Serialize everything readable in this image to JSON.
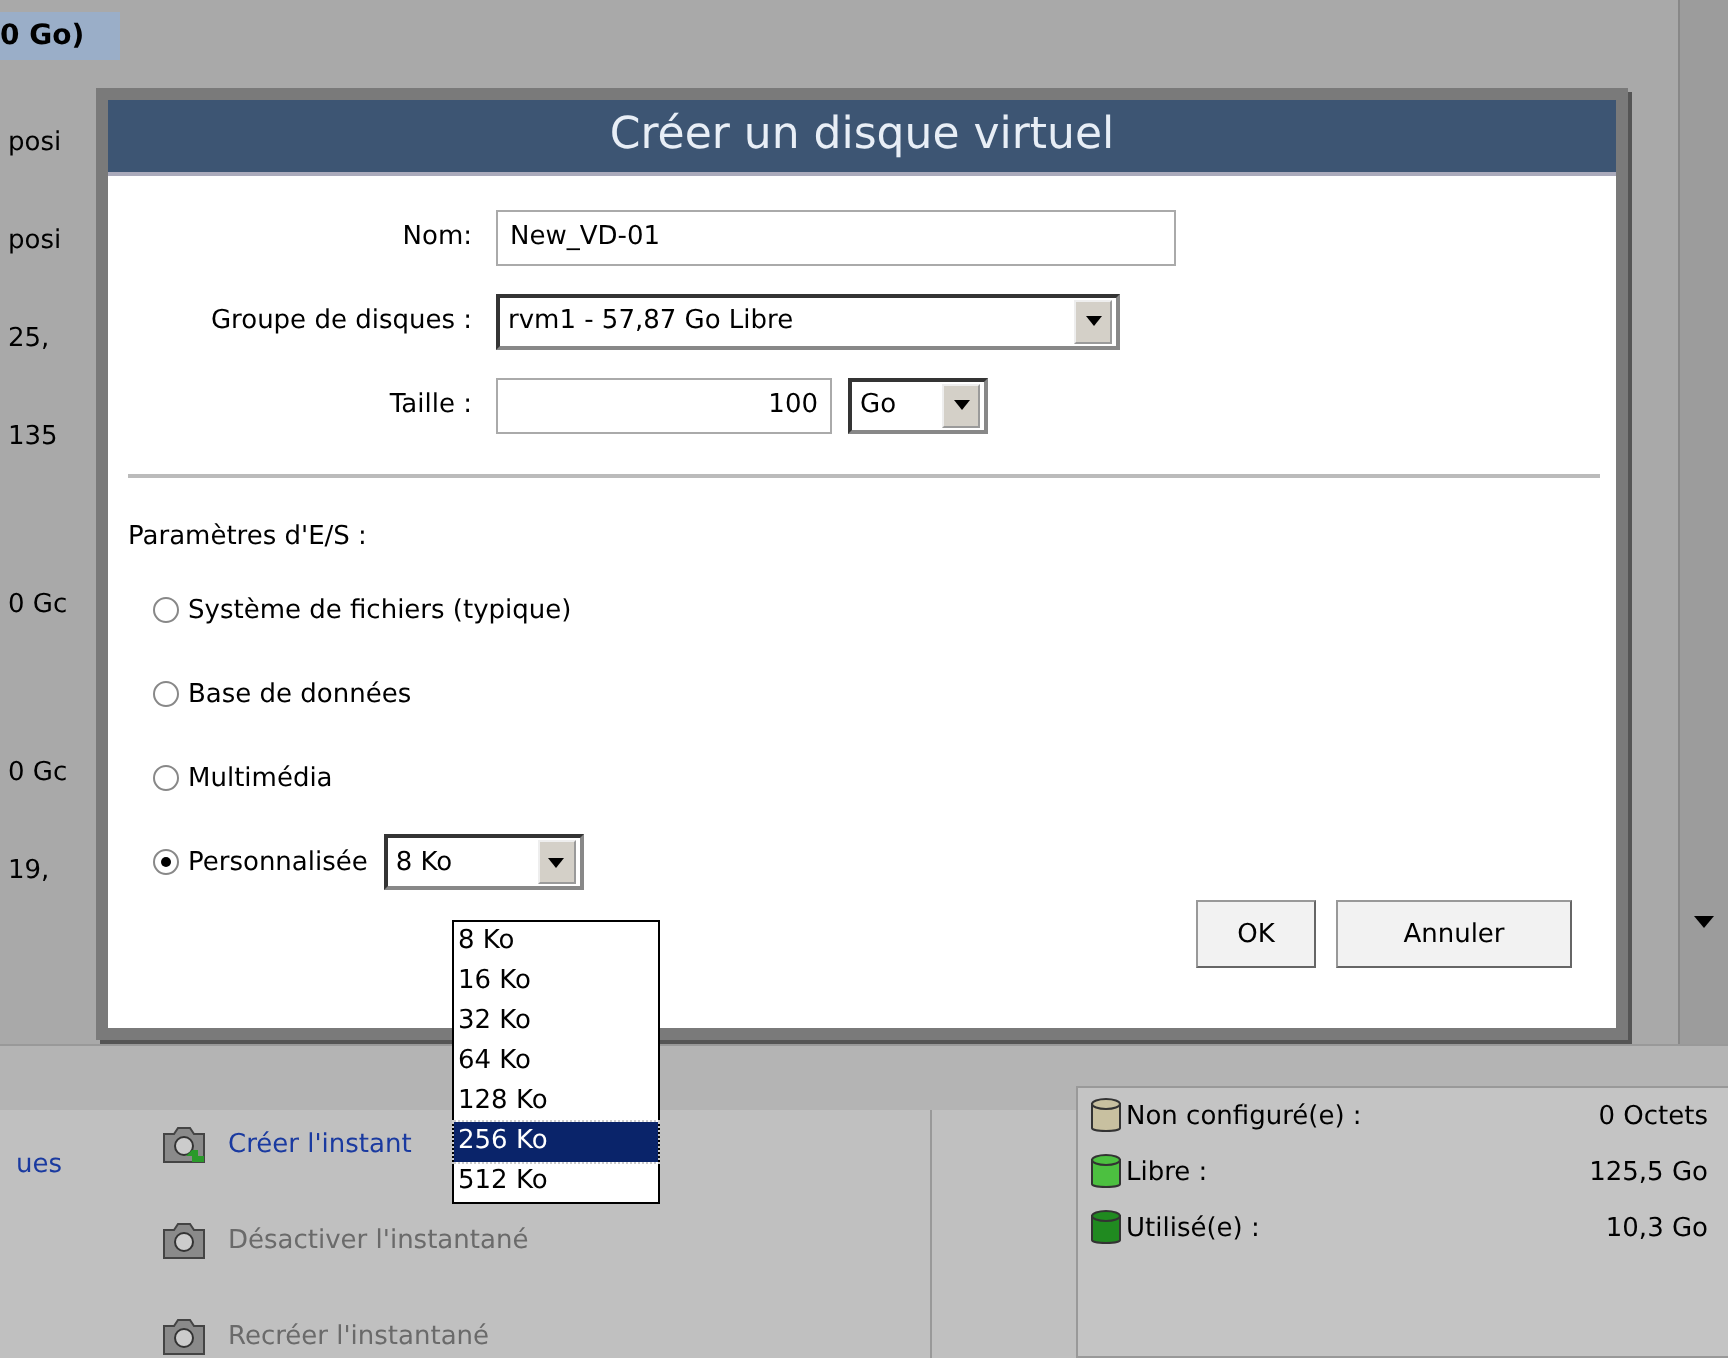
{
  "background": {
    "column_fragments": [
      {
        "text": "0 Go)",
        "kind": "header"
      },
      {
        "text": "posi",
        "kind": "cell"
      },
      {
        "text": "posi",
        "kind": "cell"
      },
      {
        "text": "25,",
        "kind": "cell"
      },
      {
        "text": "135",
        "kind": "cell"
      },
      {
        "text": "0 Gc",
        "kind": "cell"
      },
      {
        "text": "0 Gc",
        "kind": "cell"
      },
      {
        "text": "19,",
        "kind": "cell"
      }
    ],
    "left_link": "ues",
    "actions": [
      {
        "label": "Créer l'instant",
        "disabled": false
      },
      {
        "label": "Désactiver l'instantané",
        "disabled": true
      },
      {
        "label": "Recréer l'instantané",
        "disabled": true
      }
    ],
    "legend": [
      {
        "label": "Non configuré(e) :",
        "value": "0 Octets",
        "color": "#c8c0a0"
      },
      {
        "label": "Libre :",
        "value": "125,5 Go",
        "color": "#4cc040"
      },
      {
        "label": "Utilisé(e) :",
        "value": "10,3 Go",
        "color": "#208a20"
      }
    ]
  },
  "dialog": {
    "title": "Créer un disque virtuel",
    "name": {
      "label": "Nom:",
      "value": "New_VD-01"
    },
    "disk_group": {
      "label": "Groupe de disques :",
      "value": "rvm1 - 57,87 Go Libre"
    },
    "size": {
      "label": "Taille :",
      "value": "100",
      "unit": "Go"
    },
    "io_label": "Paramètres d'E/S :",
    "io_options": [
      {
        "label": "Système de fichiers (typique)",
        "selected": false
      },
      {
        "label": "Base de données",
        "selected": false
      },
      {
        "label": "Multimédia",
        "selected": false
      },
      {
        "label": "Personnalisée",
        "selected": true
      }
    ],
    "custom_select": "8 Ko",
    "dropdown_options": [
      {
        "label": "8 Ko",
        "selected": false
      },
      {
        "label": "16 Ko",
        "selected": false
      },
      {
        "label": "32 Ko",
        "selected": false
      },
      {
        "label": "64 Ko",
        "selected": false
      },
      {
        "label": "128 Ko",
        "selected": false
      },
      {
        "label": "256 Ko",
        "selected": true
      },
      {
        "label": "512 Ko",
        "selected": false
      }
    ],
    "buttons": [
      "OK",
      "Annuler"
    ]
  }
}
